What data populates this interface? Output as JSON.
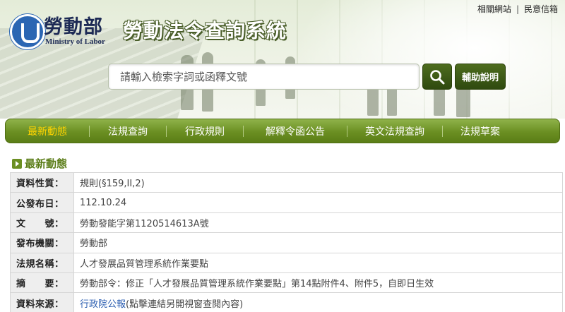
{
  "header": {
    "logo_cn": "勞動部",
    "logo_en": "Ministry of Labor",
    "site_title": "勞動法令查詢系統",
    "top_links": [
      "相關網站",
      "民意信箱"
    ],
    "top_links_separator": "|"
  },
  "search": {
    "placeholder": "請輸入檢索字詞或函釋文號",
    "value": "",
    "button_icon": "search-icon",
    "help_label": "輔助說明"
  },
  "nav": {
    "items": [
      {
        "label": "最新動態",
        "active": true
      },
      {
        "label": "法規查詢",
        "active": false
      },
      {
        "label": "行政規則",
        "active": false
      },
      {
        "label": "解釋令函公告",
        "active": false
      },
      {
        "label": "英文法規查詢",
        "active": false
      },
      {
        "label": "法規草案",
        "active": false
      }
    ]
  },
  "section": {
    "title": "最新動態",
    "rows": [
      {
        "label": "資料性質：",
        "value": "規則(§159,II,2)"
      },
      {
        "label": "公發布日：",
        "value": "112.10.24"
      },
      {
        "label": "文　　號：",
        "value": "勞動發能字第1120514613A號"
      },
      {
        "label": "發布機關：",
        "value": "勞動部"
      },
      {
        "label": "法規名稱：",
        "value": "人才發展品質管理系統作業要點"
      },
      {
        "label": "摘　　要：",
        "value": "勞動部令：修正「人才發展品質管理系統作業要點」第14點附件4、附件5，自即日生效"
      },
      {
        "label": "資料來源：",
        "link": "行政院公報",
        "value_suffix": "(點擊連結另開視窗查閱內容)"
      }
    ]
  },
  "colors": {
    "nav_green": "#6b8f22",
    "nav_active_text": "#ffd400",
    "section_title": "#5b7d18",
    "link": "#2a5db0",
    "label_bg": "#eeeeee"
  }
}
